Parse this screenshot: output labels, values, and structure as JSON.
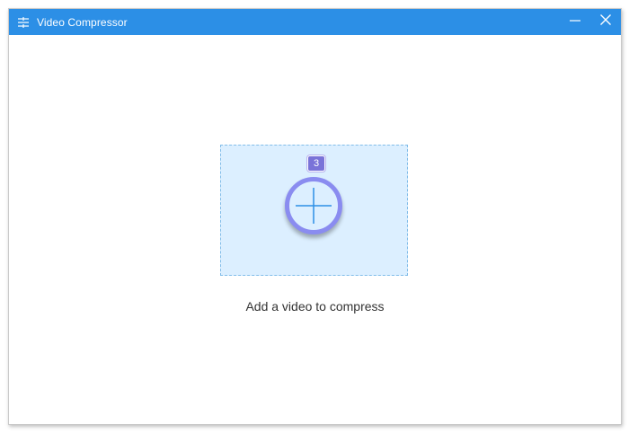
{
  "window": {
    "title": "Video Compressor",
    "app_icon": "sliders-icon",
    "controls": {
      "minimize_icon": "minimize-icon",
      "close_icon": "close-icon"
    }
  },
  "main": {
    "step_badge": "3",
    "add_icon": "plus-icon",
    "hint": "Add a video to compress"
  },
  "colors": {
    "titlebar": "#2c8fe6",
    "dropzone_bg": "#dcefff",
    "dropzone_border": "#82bde9",
    "circle_ring": "#8a8cf0",
    "plus": "#2c8fe6",
    "badge": "#7a73d8"
  }
}
